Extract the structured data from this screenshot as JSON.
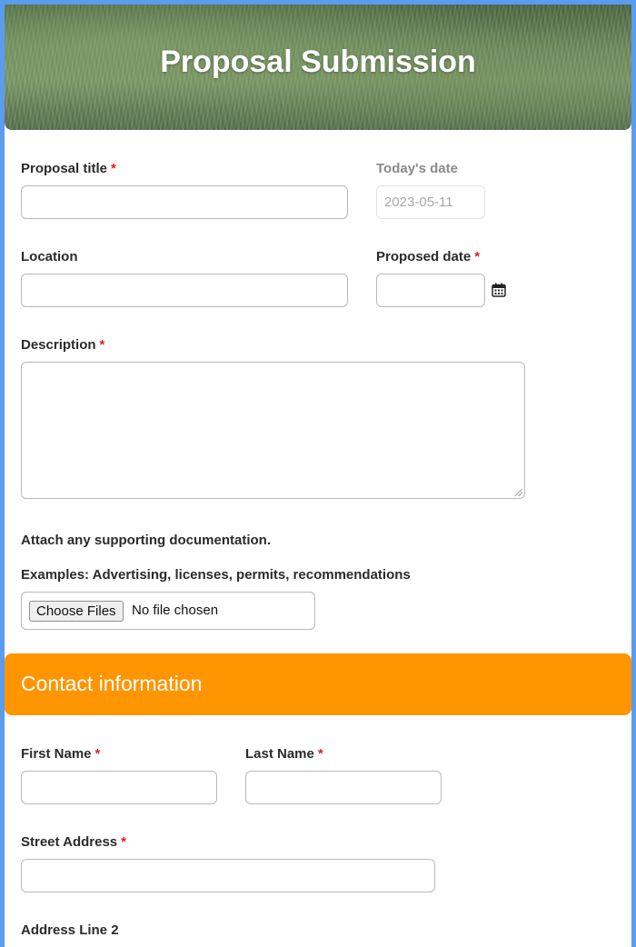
{
  "header": {
    "title": "Proposal Submission"
  },
  "form": {
    "proposal_title": {
      "label": "Proposal title",
      "required_mark": "*",
      "value": ""
    },
    "todays_date": {
      "label": "Today's date",
      "value": "2023-05-11"
    },
    "location": {
      "label": "Location",
      "value": ""
    },
    "proposed_date": {
      "label": "Proposed date",
      "required_mark": "*",
      "value": "",
      "icon": "calendar-icon"
    },
    "description": {
      "label": "Description",
      "required_mark": "*",
      "value": ""
    },
    "attachments": {
      "heading": "Attach any supporting documentation.",
      "examples": "Examples: Advertising, licenses, permits, recommendations",
      "button_label": "Choose Files",
      "status": "No file chosen"
    }
  },
  "contact_section": {
    "title": "Contact information",
    "color": "#ff9500",
    "first_name": {
      "label": "First Name",
      "required_mark": "*",
      "value": ""
    },
    "last_name": {
      "label": "Last Name",
      "required_mark": "*",
      "value": ""
    },
    "street_address": {
      "label": "Street Address",
      "required_mark": "*",
      "value": ""
    },
    "address_line_2": {
      "label": "Address Line 2"
    }
  },
  "colors": {
    "frame": "#5b9bf0",
    "required": "#e02020"
  }
}
